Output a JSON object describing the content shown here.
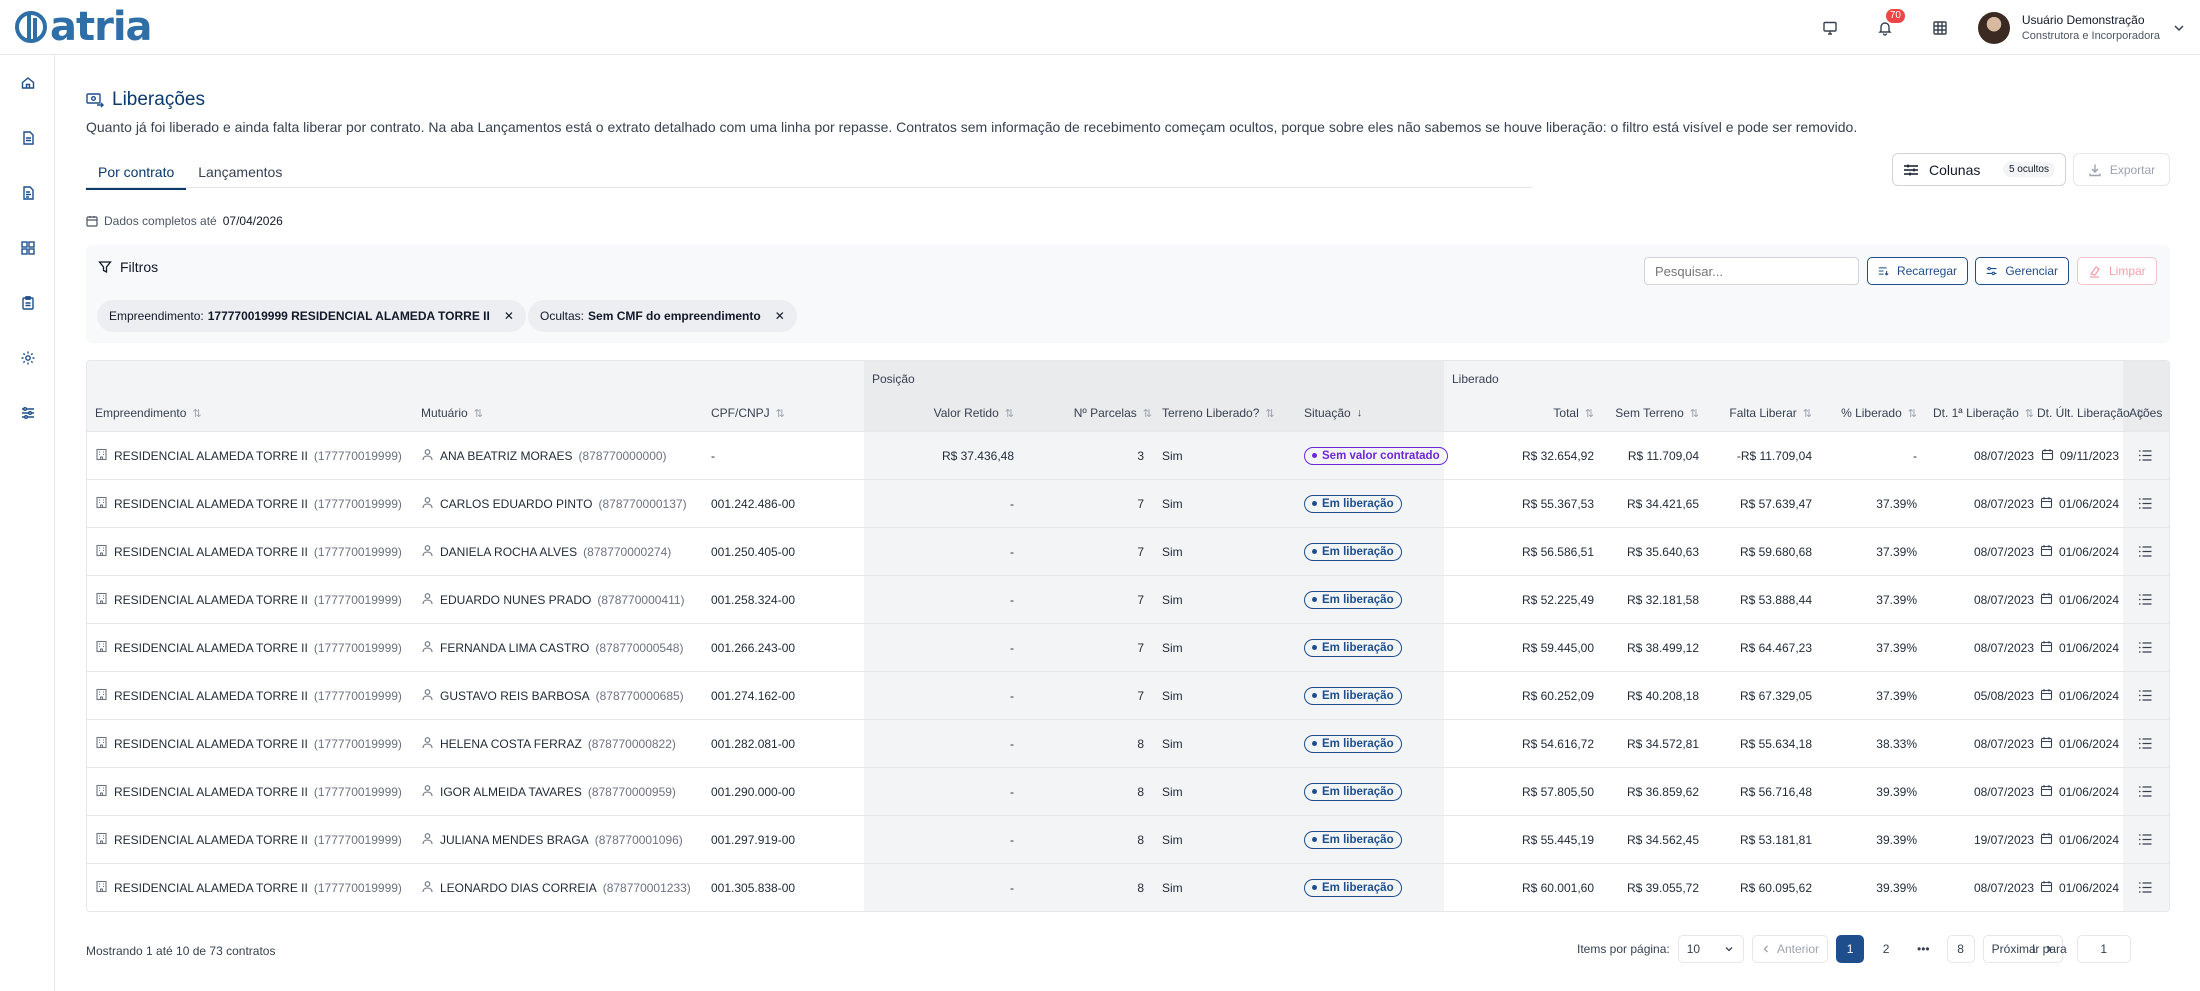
{
  "brand": {
    "name": "atria",
    "color": "#2f6fa8"
  },
  "topbar": {
    "notifications_count": "70",
    "user_name": "Usuário Demonstração",
    "user_role": "Construtora e Incorporadora"
  },
  "page": {
    "title": "Liberações",
    "description": "Quanto já foi liberado e ainda falta liberar por contrato. Na aba Lançamentos está o extrato detalhado com uma linha por repasse. Contratos sem informação de recebimento começam ocultos, porque sobre eles não sabemos se houve liberação: o filtro está visível e pode ser removido.",
    "tabs": [
      {
        "label": "Por contrato",
        "active": true
      },
      {
        "label": "Lançamentos",
        "active": false
      }
    ],
    "columns_button": "Colunas",
    "columns_hidden": "5 ocultos",
    "export_button": "Exportar",
    "data_info_label": "Dados completos até",
    "data_info_date": "07/04/2026"
  },
  "filters": {
    "title": "Filtros",
    "search_placeholder": "Pesquisar...",
    "reload": "Recarregar",
    "manage": "Gerenciar",
    "clear": "Limpar",
    "chips": [
      {
        "key": "Empreendimento:",
        "value": "177770019999 RESIDENCIAL ALAMEDA TORRE II"
      },
      {
        "key": "Ocultas:",
        "value": "Sem CMF do empreendimento"
      }
    ]
  },
  "table": {
    "groups": {
      "posicao": "Posição",
      "liberado": "Liberado"
    },
    "headers": {
      "empreendimento": "Empreendimento",
      "mutuario": "Mutuário",
      "cpf": "CPF/CNPJ",
      "valor_retido": "Valor Retido",
      "parcelas": "Nº Parcelas",
      "terreno": "Terreno Liberado?",
      "situacao": "Situação",
      "total": "Total",
      "sem_terreno": "Sem Terreno",
      "falta": "Falta Liberar",
      "pct": "% Liberado",
      "dt_primeira": "Dt. 1ª Liberação",
      "dt_ultima": "Dt. Últ. Liberação",
      "acoes": "Ações"
    },
    "rows": [
      {
        "emp": "RESIDENCIAL ALAMEDA TORRE II",
        "emp_code": "(177770019999)",
        "mut": "ANA BEATRIZ MORAES",
        "mut_code": "(878770000000)",
        "cpf": "-",
        "retido": "R$ 37.436,48",
        "parcelas": "3",
        "terreno": "Sim",
        "situacao": "Sem valor contratado",
        "total": "R$ 32.654,92",
        "sem_terreno": "R$ 11.709,04",
        "falta": "-R$ 11.709,04",
        "pct": "-",
        "dt1": "08/07/2023",
        "dt2": "09/11/2023"
      },
      {
        "emp": "RESIDENCIAL ALAMEDA TORRE II",
        "emp_code": "(177770019999)",
        "mut": "CARLOS EDUARDO PINTO",
        "mut_code": "(878770000137)",
        "cpf": "001.242.486-00",
        "retido": "-",
        "parcelas": "7",
        "terreno": "Sim",
        "situacao": "Em liberação",
        "total": "R$ 55.367,53",
        "sem_terreno": "R$ 34.421,65",
        "falta": "R$ 57.639,47",
        "pct": "37.39%",
        "dt1": "08/07/2023",
        "dt2": "01/06/2024"
      },
      {
        "emp": "RESIDENCIAL ALAMEDA TORRE II",
        "emp_code": "(177770019999)",
        "mut": "DANIELA ROCHA ALVES",
        "mut_code": "(878770000274)",
        "cpf": "001.250.405-00",
        "retido": "-",
        "parcelas": "7",
        "terreno": "Sim",
        "situacao": "Em liberação",
        "total": "R$ 56.586,51",
        "sem_terreno": "R$ 35.640,63",
        "falta": "R$ 59.680,68",
        "pct": "37.39%",
        "dt1": "08/07/2023",
        "dt2": "01/06/2024"
      },
      {
        "emp": "RESIDENCIAL ALAMEDA TORRE II",
        "emp_code": "(177770019999)",
        "mut": "EDUARDO NUNES PRADO",
        "mut_code": "(878770000411)",
        "cpf": "001.258.324-00",
        "retido": "-",
        "parcelas": "7",
        "terreno": "Sim",
        "situacao": "Em liberação",
        "total": "R$ 52.225,49",
        "sem_terreno": "R$ 32.181,58",
        "falta": "R$ 53.888,44",
        "pct": "37.39%",
        "dt1": "08/07/2023",
        "dt2": "01/06/2024"
      },
      {
        "emp": "RESIDENCIAL ALAMEDA TORRE II",
        "emp_code": "(177770019999)",
        "mut": "FERNANDA LIMA CASTRO",
        "mut_code": "(878770000548)",
        "cpf": "001.266.243-00",
        "retido": "-",
        "parcelas": "7",
        "terreno": "Sim",
        "situacao": "Em liberação",
        "total": "R$ 59.445,00",
        "sem_terreno": "R$ 38.499,12",
        "falta": "R$ 64.467,23",
        "pct": "37.39%",
        "dt1": "08/07/2023",
        "dt2": "01/06/2024"
      },
      {
        "emp": "RESIDENCIAL ALAMEDA TORRE II",
        "emp_code": "(177770019999)",
        "mut": "GUSTAVO REIS BARBOSA",
        "mut_code": "(878770000685)",
        "cpf": "001.274.162-00",
        "retido": "-",
        "parcelas": "7",
        "terreno": "Sim",
        "situacao": "Em liberação",
        "total": "R$ 60.252,09",
        "sem_terreno": "R$ 40.208,18",
        "falta": "R$ 67.329,05",
        "pct": "37.39%",
        "dt1": "05/08/2023",
        "dt2": "01/06/2024"
      },
      {
        "emp": "RESIDENCIAL ALAMEDA TORRE II",
        "emp_code": "(177770019999)",
        "mut": "HELENA COSTA FERRAZ",
        "mut_code": "(878770000822)",
        "cpf": "001.282.081-00",
        "retido": "-",
        "parcelas": "8",
        "terreno": "Sim",
        "situacao": "Em liberação",
        "total": "R$ 54.616,72",
        "sem_terreno": "R$ 34.572,81",
        "falta": "R$ 55.634,18",
        "pct": "38.33%",
        "dt1": "08/07/2023",
        "dt2": "01/06/2024"
      },
      {
        "emp": "RESIDENCIAL ALAMEDA TORRE II",
        "emp_code": "(177770019999)",
        "mut": "IGOR ALMEIDA TAVARES",
        "mut_code": "(878770000959)",
        "cpf": "001.290.000-00",
        "retido": "-",
        "parcelas": "8",
        "terreno": "Sim",
        "situacao": "Em liberação",
        "total": "R$ 57.805,50",
        "sem_terreno": "R$ 36.859,62",
        "falta": "R$ 56.716,48",
        "pct": "39.39%",
        "dt1": "08/07/2023",
        "dt2": "01/06/2024"
      },
      {
        "emp": "RESIDENCIAL ALAMEDA TORRE II",
        "emp_code": "(177770019999)",
        "mut": "JULIANA MENDES BRAGA",
        "mut_code": "(878770001096)",
        "cpf": "001.297.919-00",
        "retido": "-",
        "parcelas": "8",
        "terreno": "Sim",
        "situacao": "Em liberação",
        "total": "R$ 55.445,19",
        "sem_terreno": "R$ 34.562,45",
        "falta": "R$ 53.181,81",
        "pct": "39.39%",
        "dt1": "19/07/2023",
        "dt2": "01/06/2024"
      },
      {
        "emp": "RESIDENCIAL ALAMEDA TORRE II",
        "emp_code": "(177770019999)",
        "mut": "LEONARDO DIAS CORREIA",
        "mut_code": "(878770001233)",
        "cpf": "001.305.838-00",
        "retido": "-",
        "parcelas": "8",
        "terreno": "Sim",
        "situacao": "Em liberação",
        "total": "R$ 60.001,60",
        "sem_terreno": "R$ 39.055,72",
        "falta": "R$ 60.095,62",
        "pct": "39.39%",
        "dt1": "08/07/2023",
        "dt2": "01/06/2024"
      }
    ]
  },
  "footer": {
    "showing": "Mostrando 1 até 10 de 73 contratos",
    "per_page_label": "Items por página:",
    "per_page": "10",
    "prev": "Anterior",
    "next": "Próxima",
    "pages": [
      "1",
      "2",
      "•••",
      "8"
    ],
    "goto_label": "Ir para",
    "goto_value": "1"
  },
  "colors": {
    "primary": "#1e4e8c",
    "title": "#0b3a6b",
    "purple": "#6d28d9",
    "badge": "#ef4444"
  }
}
